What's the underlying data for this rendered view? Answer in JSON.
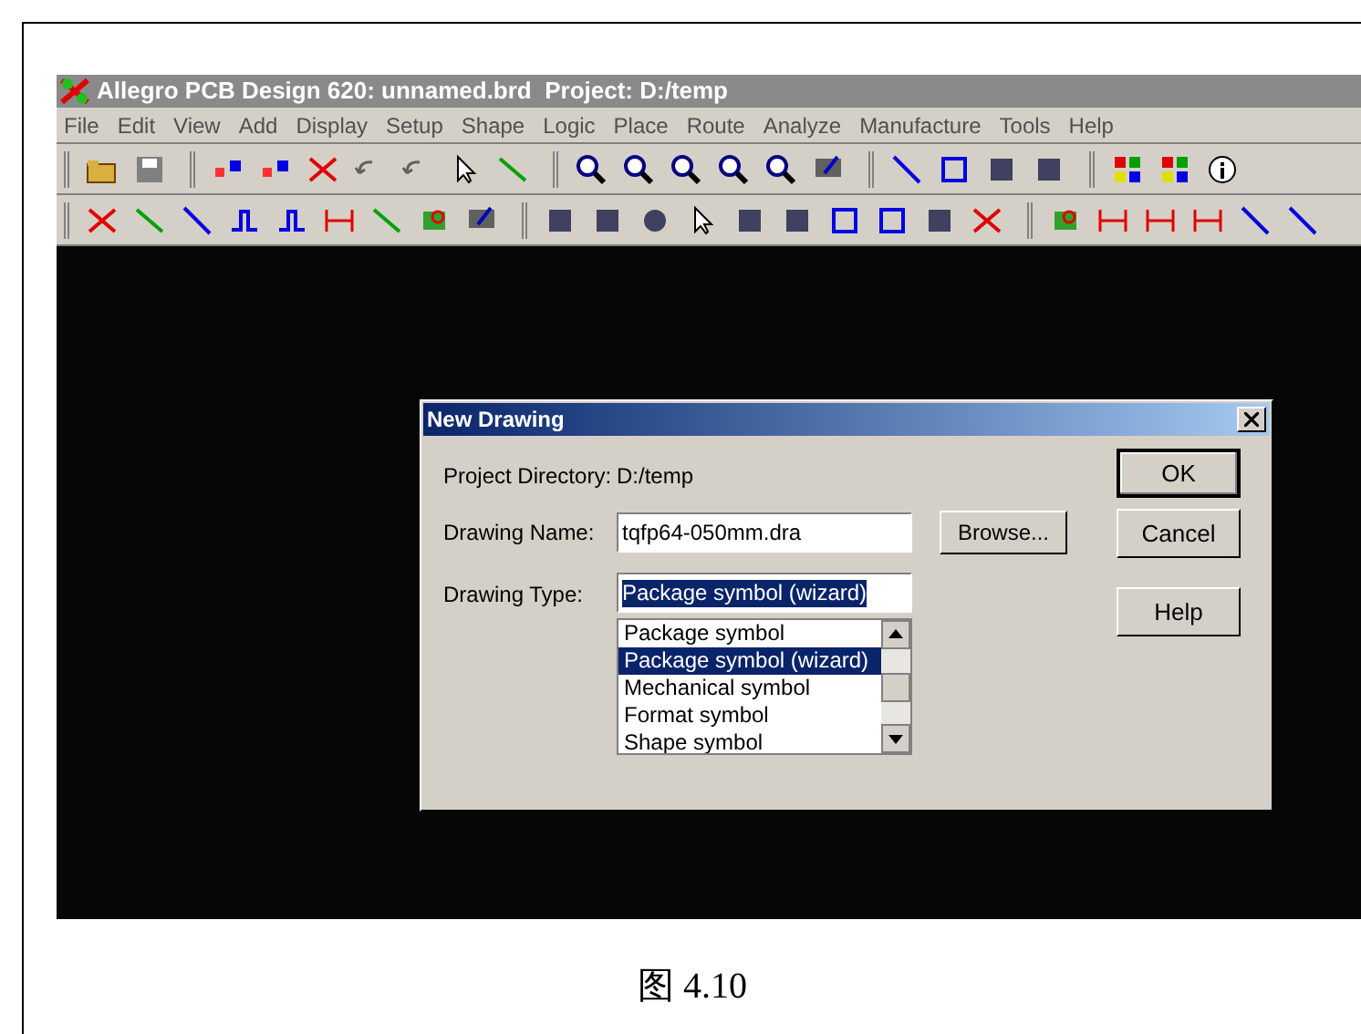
{
  "window": {
    "title": "Allegro PCB Design 620: unnamed.brd  Project: D:/temp"
  },
  "menu": [
    "File",
    "Edit",
    "View",
    "Add",
    "Display",
    "Setup",
    "Shape",
    "Logic",
    "Place",
    "Route",
    "Analyze",
    "Manufacture",
    "Tools",
    "Help"
  ],
  "dialog": {
    "title": "New Drawing",
    "project_directory": {
      "label": "Project Directory:",
      "value": "D:/temp"
    },
    "drawing_name": {
      "label": "Drawing Name:",
      "value": "tqfp64-050mm.dra"
    },
    "drawing_type": {
      "label": "Drawing Type:",
      "value": "Package symbol (wizard)"
    },
    "type_list": [
      {
        "label": "Package symbol",
        "selected": false
      },
      {
        "label": "Package symbol (wizard)",
        "selected": true
      },
      {
        "label": "Mechanical symbol",
        "selected": false
      },
      {
        "label": "Format symbol",
        "selected": false
      },
      {
        "label": "Shape symbol",
        "selected": false
      }
    ],
    "browse_button": "Browse...",
    "buttons": [
      {
        "label": "OK",
        "default": true
      },
      {
        "label": "Cancel",
        "default": false
      },
      {
        "label": "Help",
        "default": false
      }
    ]
  },
  "caption": "图 4.10"
}
